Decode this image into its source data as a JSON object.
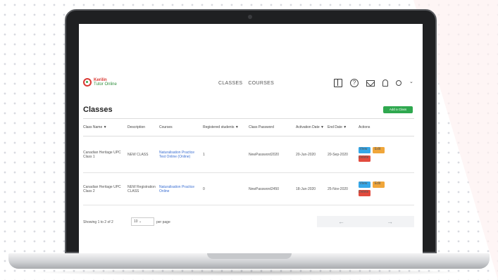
{
  "app": {
    "logo_line1": "Kerilin",
    "logo_line2": "Tutor Online"
  },
  "nav": {
    "classes": "CLASSES",
    "courses": "COURSES"
  },
  "header_icons": [
    "book-icon",
    "help-icon",
    "mail-icon",
    "bell-icon",
    "user-icon",
    "chevron-down-icon"
  ],
  "page": {
    "title": "Classes",
    "add_button": "Add a Class"
  },
  "table": {
    "columns": [
      "Class Name ▼",
      "Description",
      "Courses",
      "Registered students ▼",
      "Class Password",
      "Activation Date ▼",
      "End Date ▼",
      "Actions"
    ],
    "rows": [
      {
        "name": "Canadian Heritage UPC Class 1",
        "description": "NEW CLASS",
        "courses": "Naturalisation Practice Test Online (Online)",
        "students": "1",
        "password": "NewPassword2020",
        "activation": "20-Jun-2020",
        "end": "20-Sep-2020"
      },
      {
        "name": "Canadian Heritage UPC Class 2",
        "description": "NEW Registration CLASS",
        "courses": "Naturalisation Practice Online",
        "students": "0",
        "password": "NewPassword2450",
        "activation": "18-Jun-2020",
        "end": "25-Nov-2020"
      }
    ],
    "actions": {
      "view": "View",
      "edit": "Edit",
      "delete": "Delete"
    }
  },
  "pagination": {
    "summary": "Showing 1 to 2 of 2",
    "per_page_value": "10",
    "per_page_label": "per page",
    "prev": "←",
    "next": "→"
  },
  "colors": {
    "add_button": "#2fa84f",
    "view": "#35a7e8",
    "edit": "#f0a63a",
    "delete": "#e24b3e",
    "link": "#3b6fd2"
  }
}
